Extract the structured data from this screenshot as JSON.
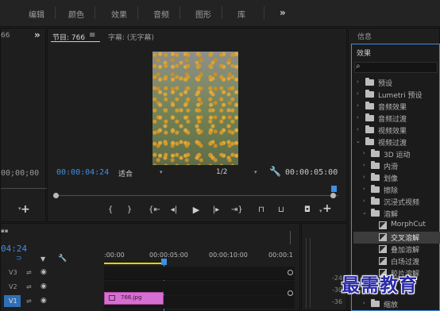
{
  "workspace": {
    "tabs": [
      "编辑",
      "颜色",
      "效果",
      "音频",
      "图形",
      "库"
    ],
    "more": "»"
  },
  "left_panel": {
    "clip_fragment": "66",
    "timecode": "00;00;00",
    "more": "»",
    "add": "+"
  },
  "program": {
    "tab_label": "节目: 766",
    "menu_icon": "≡",
    "subtitle_tab": "字幕: (无字幕)",
    "current_timecode": "00:00:04:24",
    "fit_option": "适合",
    "resolution": "1/2",
    "duration": "00:00:05:00",
    "add": "+"
  },
  "info_panel": {
    "title": "信息"
  },
  "effects": {
    "title": "效果",
    "search_placeholder": "",
    "items": [
      {
        "label": "预设",
        "type": "folder-star",
        "level": 0,
        "open": false
      },
      {
        "label": "Lumetri 预设",
        "type": "folder-star",
        "level": 0,
        "open": false
      },
      {
        "label": "音频效果",
        "type": "folder",
        "level": 0,
        "open": false
      },
      {
        "label": "音频过渡",
        "type": "folder",
        "level": 0,
        "open": false
      },
      {
        "label": "视频效果",
        "type": "folder",
        "level": 0,
        "open": false
      },
      {
        "label": "视频过渡",
        "type": "folder",
        "level": 0,
        "open": true
      },
      {
        "label": "3D 运动",
        "type": "folder",
        "level": 1,
        "open": false
      },
      {
        "label": "内滑",
        "type": "folder",
        "level": 1,
        "open": false
      },
      {
        "label": "划像",
        "type": "folder",
        "level": 1,
        "open": false
      },
      {
        "label": "擦除",
        "type": "folder",
        "level": 1,
        "open": false
      },
      {
        "label": "沉浸式视频",
        "type": "folder",
        "level": 1,
        "open": false
      },
      {
        "label": "溶解",
        "type": "folder",
        "level": 1,
        "open": true
      },
      {
        "label": "MorphCut",
        "type": "effect",
        "level": 2
      },
      {
        "label": "交叉溶解",
        "type": "effect",
        "level": 2,
        "selected": true
      },
      {
        "label": "叠加溶解",
        "type": "effect",
        "level": 2
      },
      {
        "label": "白场过渡",
        "type": "effect",
        "level": 2
      },
      {
        "label": "胶片溶解",
        "type": "effect",
        "level": 2
      },
      {
        "label": "缩放",
        "type": "folder",
        "level": 1,
        "open": false
      }
    ]
  },
  "timeline": {
    "timecode": "04:24",
    "ruler_ticks": [
      ":00:00",
      "00:00:05:00",
      "00:00:10:00",
      "00:00:1"
    ],
    "tracks": [
      "V3",
      "V2",
      "V1"
    ],
    "clip_name": "766.jpg",
    "clip_color": "#d66fd2"
  },
  "audio_meter": {
    "ticks": [
      "-24",
      "-30",
      "-36"
    ]
  },
  "watermark": "最需教育",
  "colors": {
    "accent_blue": "#3f8fe0",
    "clip_pink": "#d66fd2",
    "playhead": "#3f8fe0",
    "in_out_bar": "#e5d200"
  }
}
